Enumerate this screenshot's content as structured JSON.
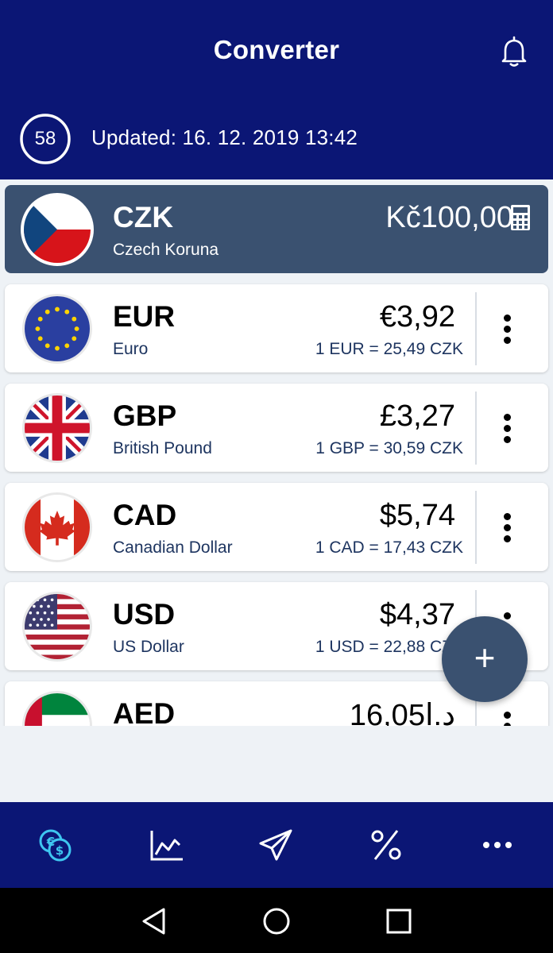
{
  "header": {
    "title": "Converter",
    "countdown": "58",
    "updated": "Updated: 16. 12. 2019 13:42"
  },
  "base": {
    "code": "CZK",
    "name": "Czech Koruna",
    "amount": "Kč100,00",
    "flag": "czech-flag",
    "action_icon": "calculator-icon"
  },
  "currencies": [
    {
      "code": "EUR",
      "name": "Euro",
      "amount": "€3,92",
      "rate": "1 EUR = 25,49 CZK",
      "flag": "eu-flag"
    },
    {
      "code": "GBP",
      "name": "British Pound",
      "amount": "£3,27",
      "rate": "1 GBP = 30,59 CZK",
      "flag": "uk-flag"
    },
    {
      "code": "CAD",
      "name": "Canadian Dollar",
      "amount": "$5,74",
      "rate": "1 CAD = 17,43 CZK",
      "flag": "canada-flag"
    },
    {
      "code": "USD",
      "name": "US Dollar",
      "amount": "$4,37",
      "rate": "1 USD = 22,88 CZK",
      "flag": "us-flag"
    },
    {
      "code": "AED",
      "name": "",
      "amount": "16,05د.إ",
      "rate": "",
      "flag": "uae-flag"
    }
  ],
  "fab": {
    "label": "+"
  },
  "bottom_nav": [
    {
      "icon": "currency-exchange-icon",
      "active": true
    },
    {
      "icon": "chart-icon",
      "active": false
    },
    {
      "icon": "send-icon",
      "active": false
    },
    {
      "icon": "percent-icon",
      "active": false
    },
    {
      "icon": "more-horizontal-icon",
      "active": false
    }
  ],
  "colors": {
    "header_bg": "#0b1675",
    "base_card_bg": "#3a5170",
    "active_nav": "#3ec6f0",
    "page_bg": "#eef2f6"
  }
}
